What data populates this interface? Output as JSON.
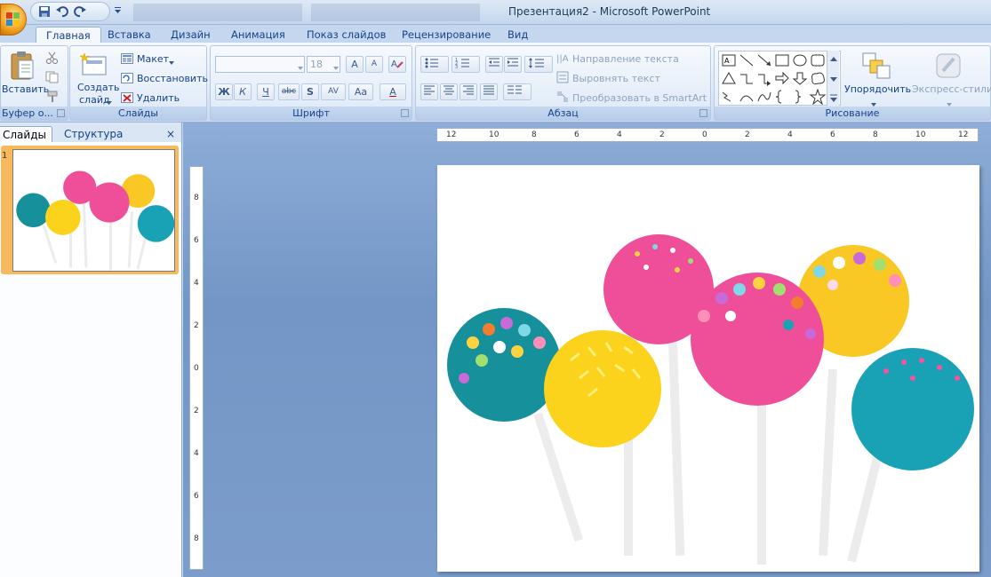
{
  "window": {
    "title": "Презентация2 - Microsoft PowerPoint"
  },
  "tabs": [
    "Главная",
    "Вставка",
    "Дизайн",
    "Анимация",
    "Показ слайдов",
    "Рецензирование",
    "Вид"
  ],
  "ribbon": {
    "clipboard": {
      "paste_label": "Вставить",
      "group_label": "Буфер о..."
    },
    "slides": {
      "new_slide_line1": "Создать",
      "new_slide_line2": "слайд",
      "layout_label": "Макет",
      "reset_label": "Восстановить",
      "delete_label": "Удалить",
      "group_label": "Слайды"
    },
    "font": {
      "font_name_value": "",
      "font_size_value": "18",
      "bold": "Ж",
      "italic": "К",
      "underline": "Ч",
      "strike": "abc",
      "shadow": "S",
      "spacing": "AV",
      "case": "Aa",
      "color": "A",
      "grow": "A",
      "shrink": "A",
      "group_label": "Шрифт"
    },
    "paragraph": {
      "text_direction": "Направление текста",
      "align_text": "Выровнять текст",
      "smartart": "Преобразовать в SmartArt",
      "group_label": "Абзац"
    },
    "drawing": {
      "arrange_label": "Упорядочить",
      "quick_styles_label": "Экспресс-стили",
      "group_label": "Рисование"
    }
  },
  "slides_pane": {
    "tab_slides": "Слайды",
    "tab_outline": "Структура",
    "close": "×",
    "slide_number": "1"
  },
  "ruler": {
    "horizontal": [
      "12",
      "10",
      "8",
      "6",
      "4",
      "2",
      "0",
      "2",
      "4",
      "6",
      "8",
      "10",
      "12"
    ],
    "vertical": [
      "8",
      "6",
      "4",
      "2",
      "0",
      "2",
      "4",
      "6",
      "8"
    ]
  },
  "colors": {
    "accent": "#15428b",
    "selection": "#f8b95c",
    "workspace": "#7a9bcb"
  }
}
